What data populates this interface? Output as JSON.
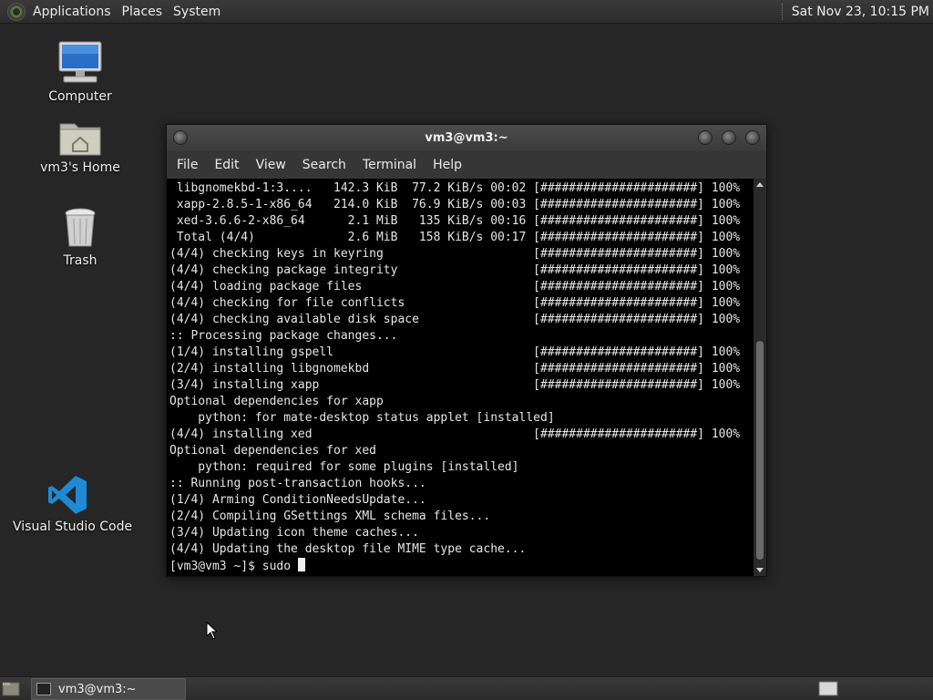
{
  "top_panel": {
    "menus": [
      "Applications",
      "Places",
      "System"
    ],
    "clock": "Sat Nov 23, 10:15 PM"
  },
  "desktop_icons": [
    {
      "label": "Computer",
      "icon": "computer-icon"
    },
    {
      "label": "vm3's Home",
      "icon": "home-folder-icon"
    },
    {
      "label": "Trash",
      "icon": "trash-icon"
    },
    {
      "label": "Visual Studio Code",
      "icon": "vscode-icon"
    }
  ],
  "window": {
    "title": "vm3@vm3:~",
    "menu": [
      "File",
      "Edit",
      "View",
      "Search",
      "Terminal",
      "Help"
    ]
  },
  "terminal": {
    "lines": [
      " libgnomekbd-1:3....   142.3 KiB  77.2 KiB/s 00:02 [######################] 100%",
      " xapp-2.8.5-1-x86_64   214.0 KiB  76.9 KiB/s 00:03 [######################] 100%",
      " xed-3.6.6-2-x86_64      2.1 MiB   135 KiB/s 00:16 [######################] 100%",
      " Total (4/4)             2.6 MiB   158 KiB/s 00:17 [######################] 100%",
      "(4/4) checking keys in keyring                     [######################] 100%",
      "(4/4) checking package integrity                   [######################] 100%",
      "(4/4) loading package files                        [######################] 100%",
      "(4/4) checking for file conflicts                  [######################] 100%",
      "(4/4) checking available disk space                [######################] 100%",
      ":: Processing package changes...",
      "(1/4) installing gspell                            [######################] 100%",
      "(2/4) installing libgnomekbd                       [######################] 100%",
      "(3/4) installing xapp                              [######################] 100%",
      "Optional dependencies for xapp",
      "    python: for mate-desktop status applet [installed]",
      "(4/4) installing xed                               [######################] 100%",
      "Optional dependencies for xed",
      "    python: required for some plugins [installed]",
      ":: Running post-transaction hooks...",
      "(1/4) Arming ConditionNeedsUpdate...",
      "(2/4) Compiling GSettings XML schema files...",
      "(3/4) Updating icon theme caches...",
      "(4/4) Updating the desktop file MIME type cache..."
    ],
    "prompt": "[vm3@vm3 ~]$ sudo "
  },
  "taskbar": {
    "task_label": "vm3@vm3:~"
  }
}
